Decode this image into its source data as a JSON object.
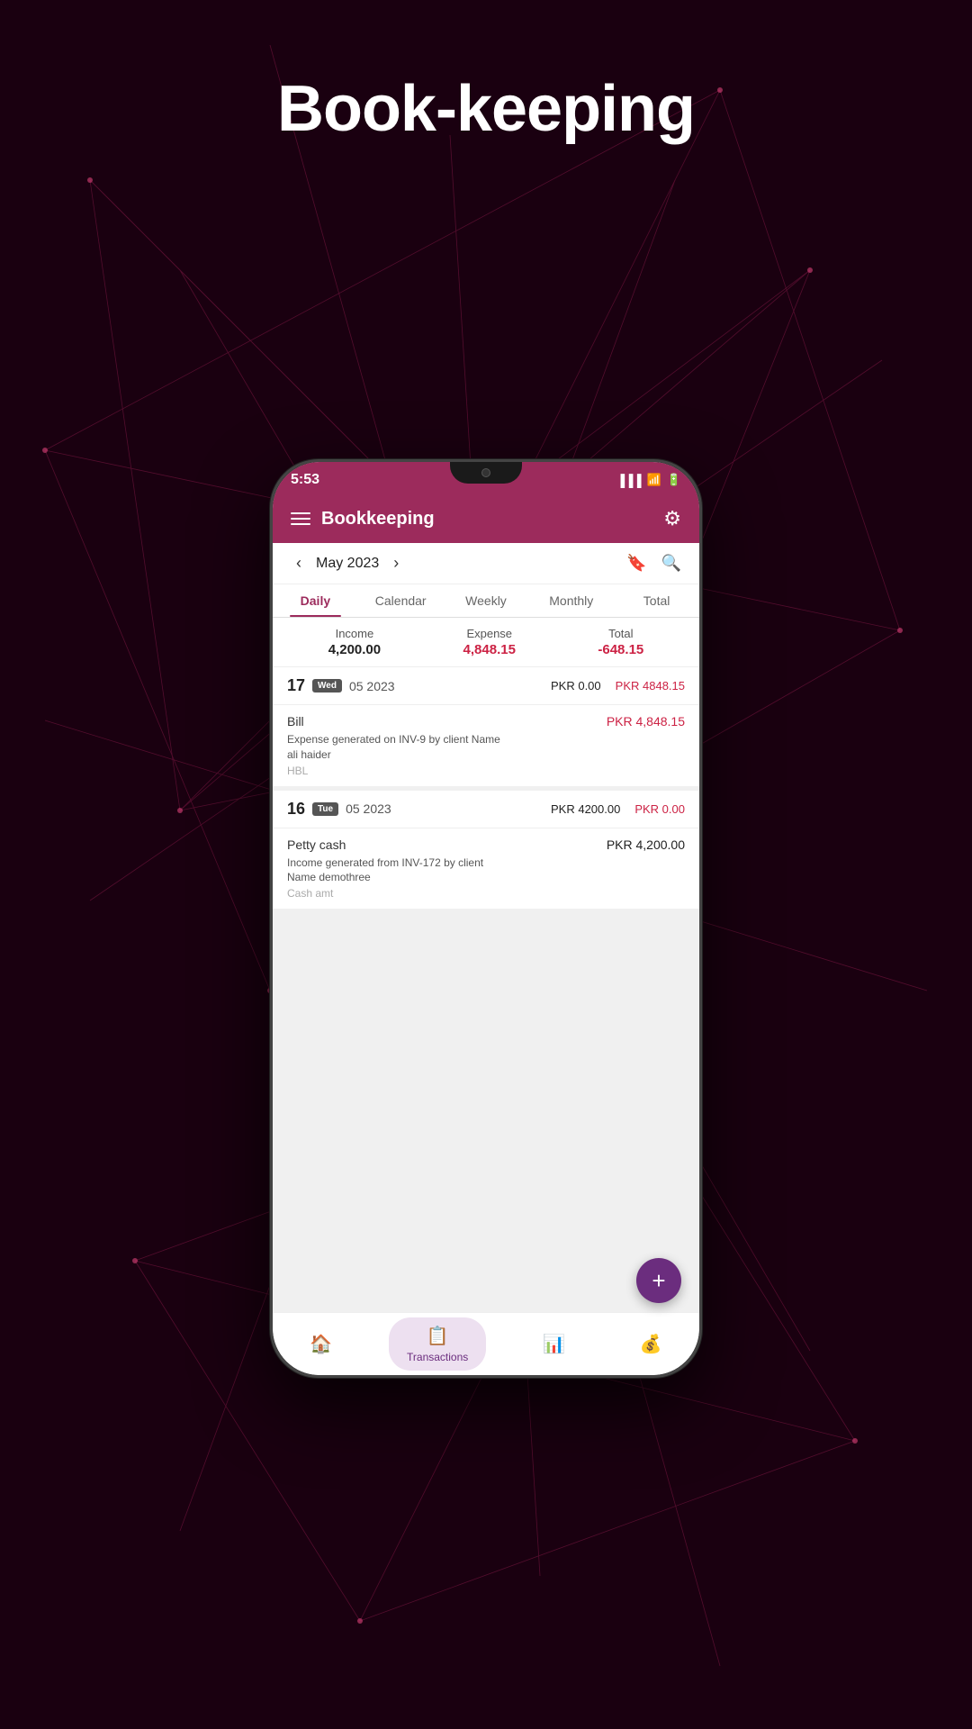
{
  "page": {
    "title": "Book-keeping"
  },
  "status_bar": {
    "time": "5:53"
  },
  "header": {
    "title": "Bookkeeping",
    "menu_label": "menu",
    "settings_label": "settings"
  },
  "month_nav": {
    "current": "May 2023",
    "prev_label": "‹",
    "next_label": "›",
    "bookmark_label": "bookmark",
    "search_label": "search"
  },
  "tabs": [
    {
      "id": "daily",
      "label": "Daily",
      "active": true
    },
    {
      "id": "calendar",
      "label": "Calendar",
      "active": false
    },
    {
      "id": "weekly",
      "label": "Weekly",
      "active": false
    },
    {
      "id": "monthly",
      "label": "Monthly",
      "active": false
    },
    {
      "id": "total",
      "label": "Total",
      "active": false
    }
  ],
  "summary": {
    "income_label": "Income",
    "income_value": "4,200.00",
    "expense_label": "Expense",
    "expense_value": "4,848.15",
    "total_label": "Total",
    "total_value": "-648.15"
  },
  "date_groups": [
    {
      "date_num": "17",
      "day": "Wed",
      "month_year": "05 2023",
      "income_amount": "PKR 0.00",
      "expense_amount": "PKR 4848.15",
      "transactions": [
        {
          "category": "Bill",
          "description": "Expense generated on INV-9 by client Name ali haider",
          "sub": "HBL",
          "amount": "PKR 4,848.15",
          "type": "expense"
        }
      ]
    },
    {
      "date_num": "16",
      "day": "Tue",
      "month_year": "05 2023",
      "income_amount": "PKR 4200.00",
      "expense_amount": "PKR 0.00",
      "transactions": [
        {
          "category": "Petty cash",
          "description": "Income generated from  INV-172 by client Name demothree",
          "sub": "Cash amt",
          "amount": "PKR 4,200.00",
          "type": "income"
        }
      ]
    }
  ],
  "fab": {
    "label": "+"
  },
  "bottom_nav": [
    {
      "id": "home",
      "label": "",
      "icon": "🏠",
      "active": false
    },
    {
      "id": "transactions",
      "label": "Transactions",
      "icon": "📋",
      "active": true
    },
    {
      "id": "stats",
      "label": "",
      "icon": "📊",
      "active": false
    },
    {
      "id": "accounts",
      "label": "",
      "icon": "💰",
      "active": false
    }
  ],
  "colors": {
    "brand": "#9c2b5c",
    "fab": "#6b2d7e",
    "expense": "#cc2244"
  }
}
